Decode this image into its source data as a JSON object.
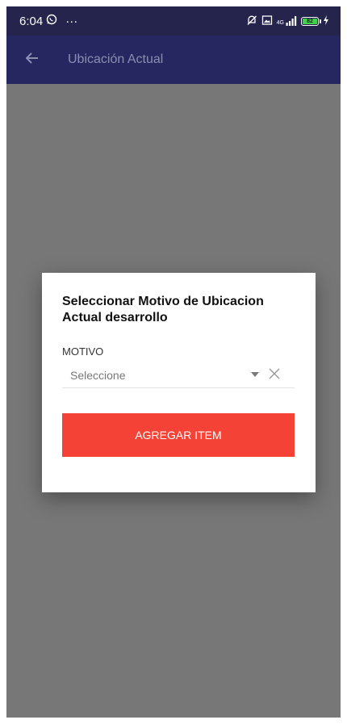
{
  "status_bar": {
    "time": "6:04",
    "whatsapp_icon": "whatsapp-icon",
    "more": "···",
    "network": "4G",
    "battery_level": "82",
    "colors": {
      "background": "#24244d",
      "battery": "#3fd34a"
    }
  },
  "app_bar": {
    "title": "Ubicación Actual",
    "back_icon": "arrow-left-icon",
    "color": "#262661"
  },
  "dialog": {
    "title": "Seleccionar Motivo de Ubicacion Actual desarrollo",
    "field_label": "MOTIVO",
    "select": {
      "value": "Seleccione",
      "dropdown_icon": "caret-down-icon",
      "clear_icon": "close-icon"
    },
    "button_label": "AGREGAR ITEM",
    "button_color": "#f44336"
  },
  "overlay_color": "#777777"
}
